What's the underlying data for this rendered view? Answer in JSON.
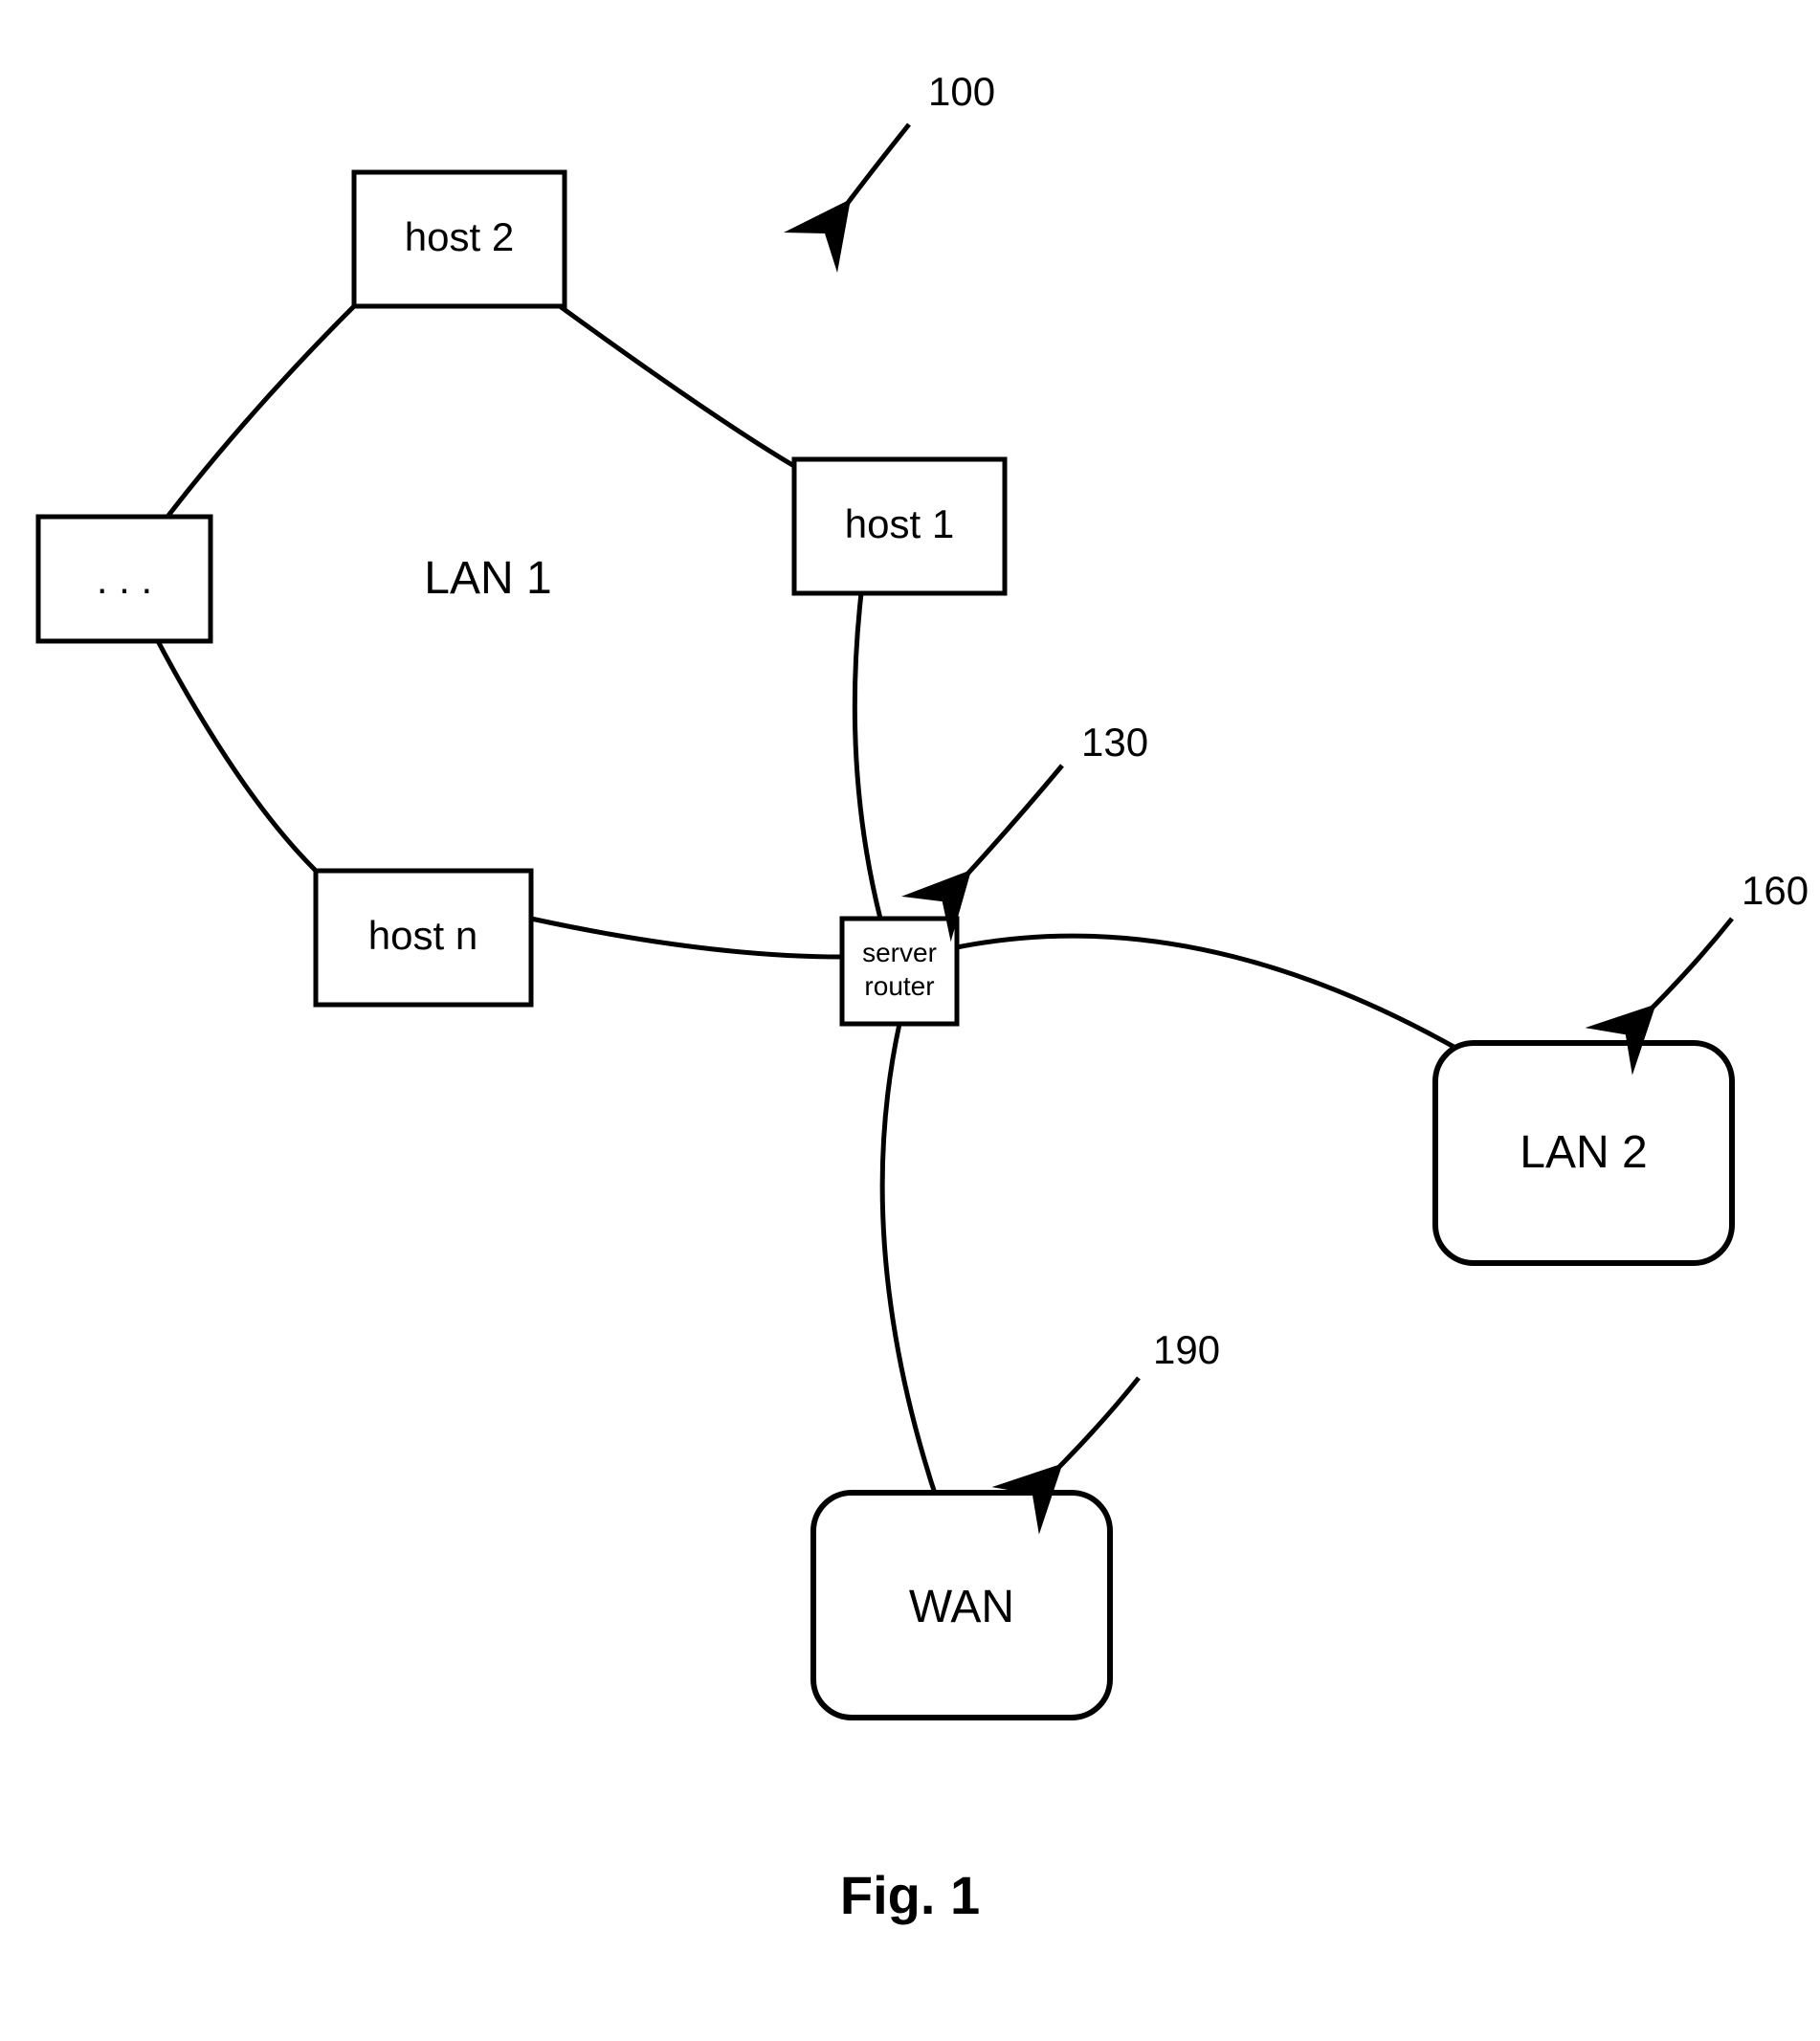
{
  "nodes": {
    "host2": "host 2",
    "host1": "host 1",
    "hostn": "host n",
    "ellipsis": ". . .",
    "server_line1": "server",
    "server_line2": "router",
    "lan1": "LAN 1",
    "lan2": "LAN 2",
    "wan": "WAN"
  },
  "refs": {
    "r100": "100",
    "r130": "130",
    "r160": "160",
    "r190": "190"
  },
  "figure": "Fig. 1"
}
